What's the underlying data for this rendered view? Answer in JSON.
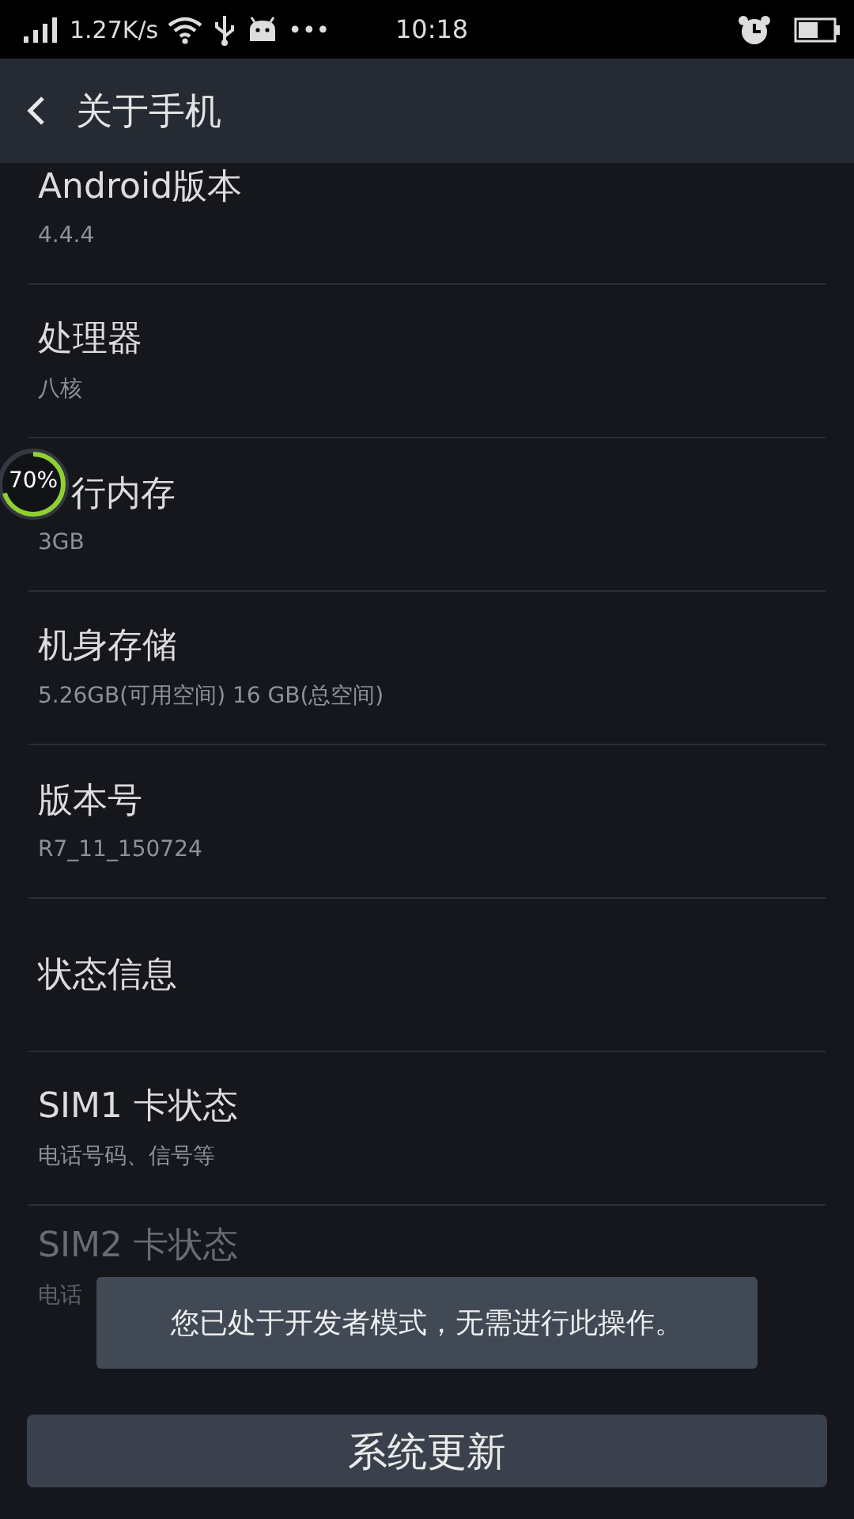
{
  "status_bar": {
    "speed": "1.27K/s",
    "more": "•••",
    "time": "10:18"
  },
  "header": {
    "title": "关于手机"
  },
  "items": [
    {
      "title": "Android版本",
      "subtitle": "4.4.4",
      "faded": false
    },
    {
      "title": "处理器",
      "subtitle": "八核",
      "faded": false
    },
    {
      "title": "行内存",
      "subtitle": "3GB",
      "faded": false,
      "widget": {
        "label": "70%",
        "level": 0.7
      }
    },
    {
      "title": "机身存储",
      "subtitle": "5.26GB(可用空间)  16 GB(总空间)",
      "faded": false
    },
    {
      "title": "版本号",
      "subtitle": "R7_11_150724",
      "faded": false
    },
    {
      "title": "状态信息",
      "faded": false
    },
    {
      "title": "SIM1 卡状态",
      "subtitle": "电话号码、信号等",
      "faded": false
    },
    {
      "title": "SIM2 卡状态",
      "subtitle": "电话",
      "faded": true
    }
  ],
  "toast": {
    "text": "您已处于开发者模式，无需进行此操作。"
  },
  "update_button": {
    "label": "系统更新"
  }
}
